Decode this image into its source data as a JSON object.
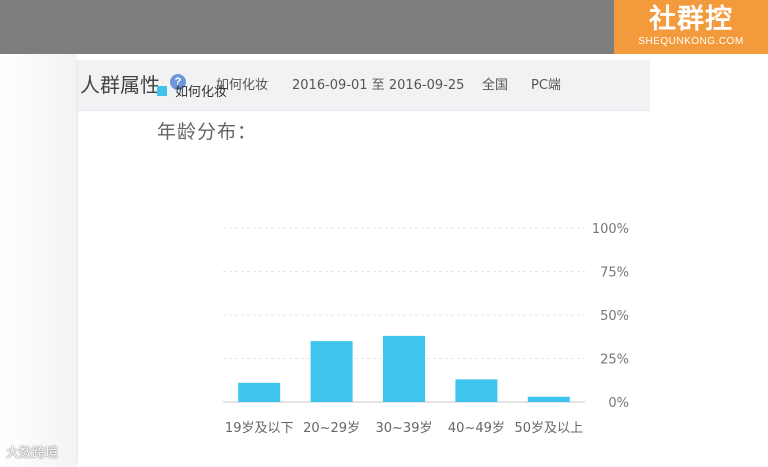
{
  "logo": {
    "cn": "社群控",
    "en": "SHEQUNKONG.COM"
  },
  "header": {
    "title": "人群属性",
    "help_glyph": "?",
    "keyword": "如何化妆",
    "date_range": "2016-09-01 至 2016-09-25",
    "region": "全国",
    "platform": "PC端"
  },
  "legend": {
    "label": "如何化妆"
  },
  "section_title": "年龄分布：",
  "watermark": "大数跨境",
  "colors": {
    "bar": "#3fc4ee",
    "logo_bg": "#f39a3c",
    "topbar": "#7d7d7d",
    "help_icon": "#6f98dc"
  },
  "chart_data": {
    "type": "bar",
    "categories": [
      "19岁及以下",
      "20~29岁",
      "30~39岁",
      "40~49岁",
      "50岁及以上"
    ],
    "values": [
      11,
      35,
      38,
      13,
      3
    ],
    "ylim": [
      0,
      100
    ],
    "y_ticks": [
      0,
      25,
      50,
      75,
      100
    ],
    "y_tick_labels": [
      "0%",
      "25%",
      "50%",
      "75%",
      "100%"
    ],
    "grid": true,
    "y_axis_side": "right"
  }
}
